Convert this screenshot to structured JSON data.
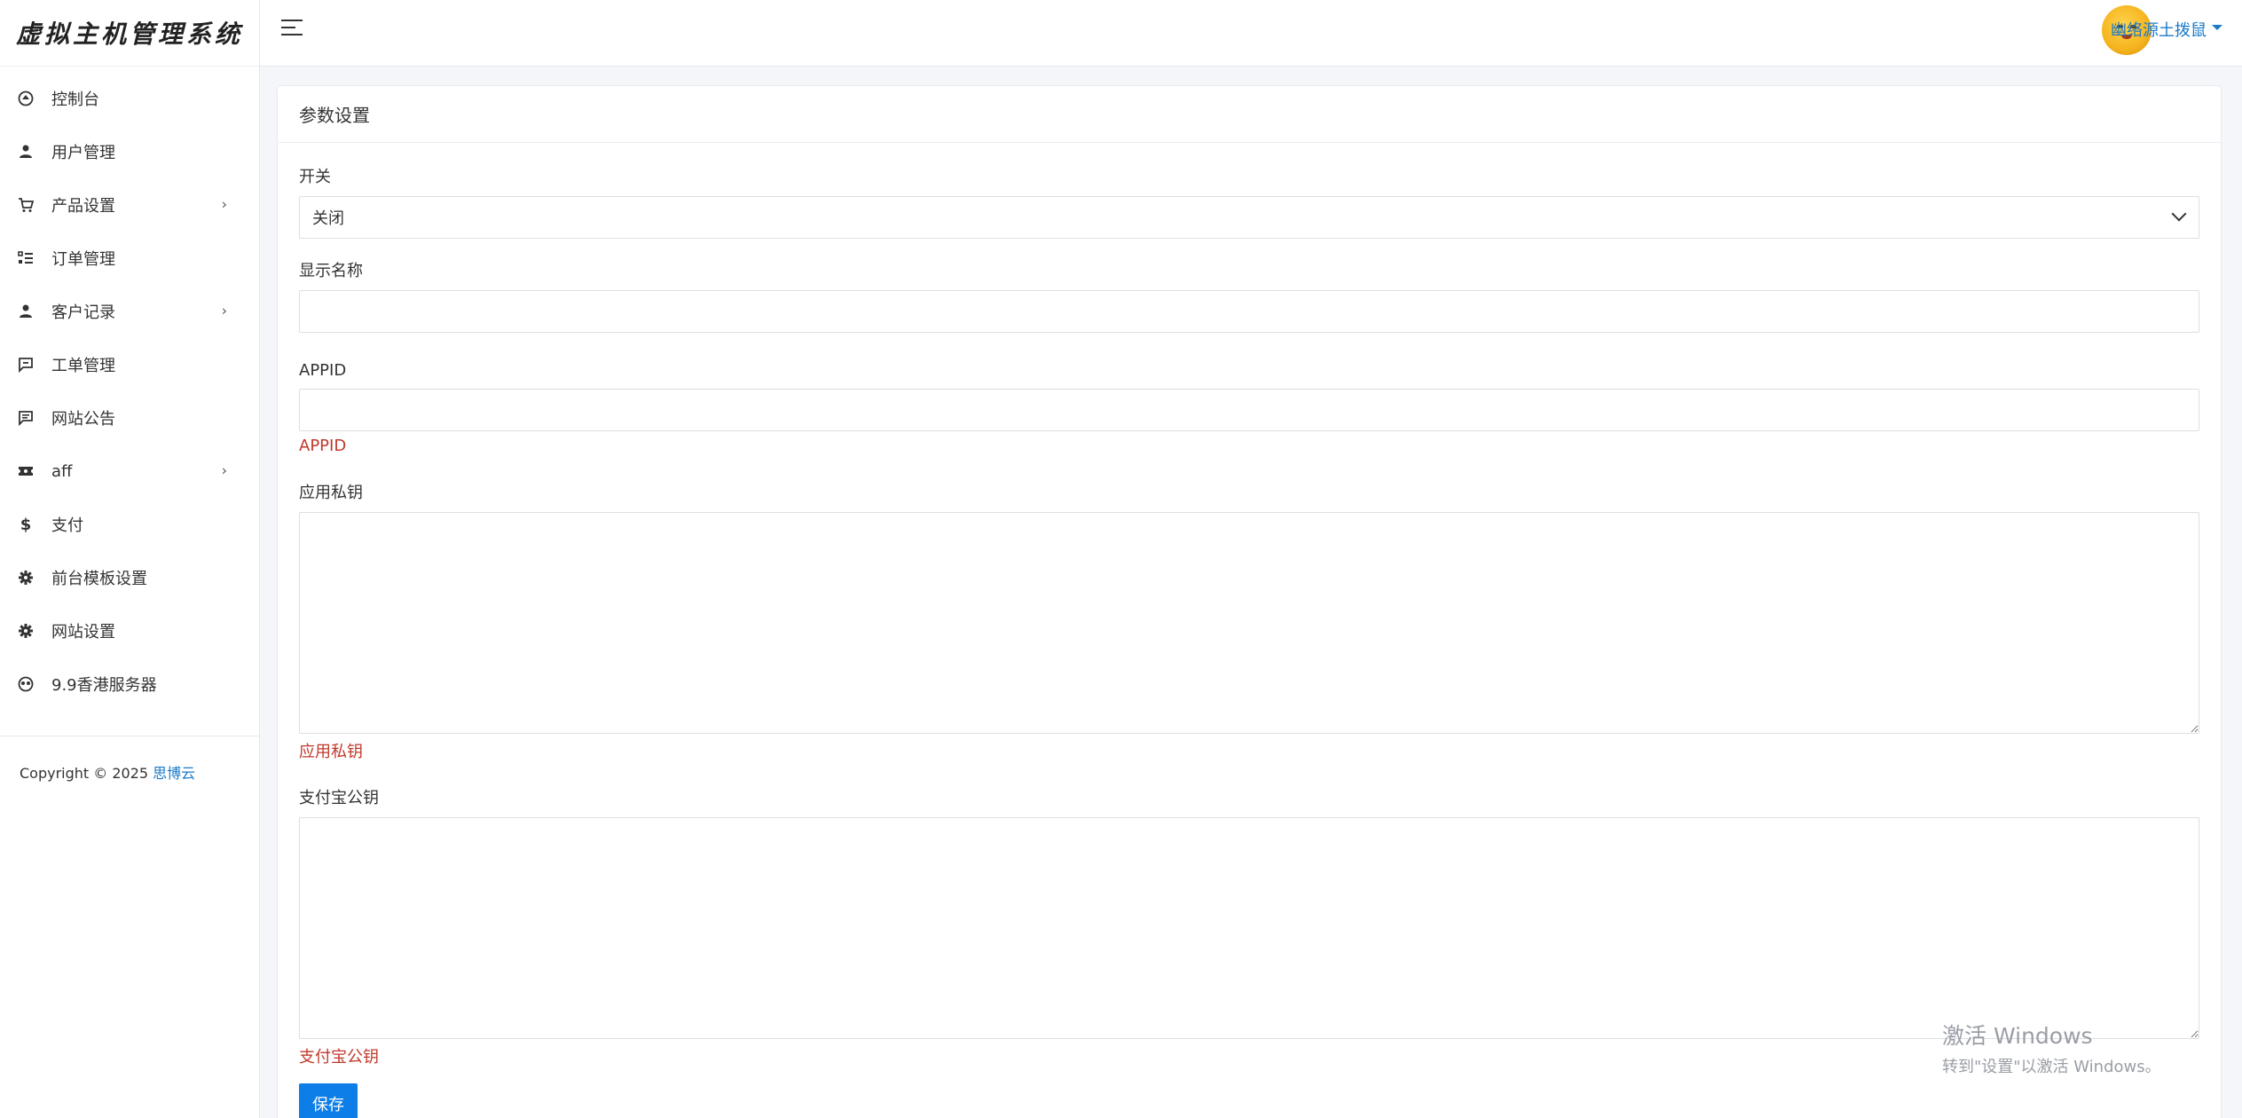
{
  "app": {
    "title": "虚拟主机管理系统"
  },
  "sidebar": {
    "items": [
      {
        "label": "控制台",
        "icon": "dashboard-icon",
        "has_children": false
      },
      {
        "label": "用户管理",
        "icon": "user-icon",
        "has_children": false
      },
      {
        "label": "产品设置",
        "icon": "cart-icon",
        "has_children": true
      },
      {
        "label": "订单管理",
        "icon": "list-icon",
        "has_children": false
      },
      {
        "label": "客户记录",
        "icon": "user-icon",
        "has_children": true
      },
      {
        "label": "工单管理",
        "icon": "ticket-icon",
        "has_children": false
      },
      {
        "label": "网站公告",
        "icon": "message-icon",
        "has_children": false
      },
      {
        "label": "aff",
        "icon": "coupon-icon",
        "has_children": true
      },
      {
        "label": "支付",
        "icon": "dollar-icon",
        "has_children": false
      },
      {
        "label": "前台模板设置",
        "icon": "gear-icon",
        "has_children": false
      },
      {
        "label": "网站设置",
        "icon": "gear-icon",
        "has_children": false
      },
      {
        "label": "9.9香港服务器",
        "icon": "mask-icon",
        "has_children": false
      }
    ],
    "chevron": "›",
    "copyright": {
      "prefix": "Copyright © 2025 ",
      "link": "思博云"
    }
  },
  "header": {
    "user_name": "幽络源土拨鼠"
  },
  "main": {
    "title": "参数设置",
    "form": {
      "switch": {
        "label": "开关",
        "value": "关闭"
      },
      "display_name": {
        "label": "显示名称",
        "value": ""
      },
      "appid": {
        "label": "APPID",
        "value": "",
        "help": "APPID"
      },
      "private_key": {
        "label": "应用私钥",
        "value": "",
        "help": "应用私钥"
      },
      "alipay_public_key": {
        "label": "支付宝公钥",
        "value": "",
        "help": "支付宝公钥"
      },
      "save_label": "保存"
    }
  },
  "watermark": {
    "title": "激活 Windows",
    "subtitle": "转到\"设置\"以激活 Windows。"
  },
  "colors": {
    "accent": "#0d7ee8",
    "link": "#1a7ac8",
    "help": "#c0392b"
  }
}
